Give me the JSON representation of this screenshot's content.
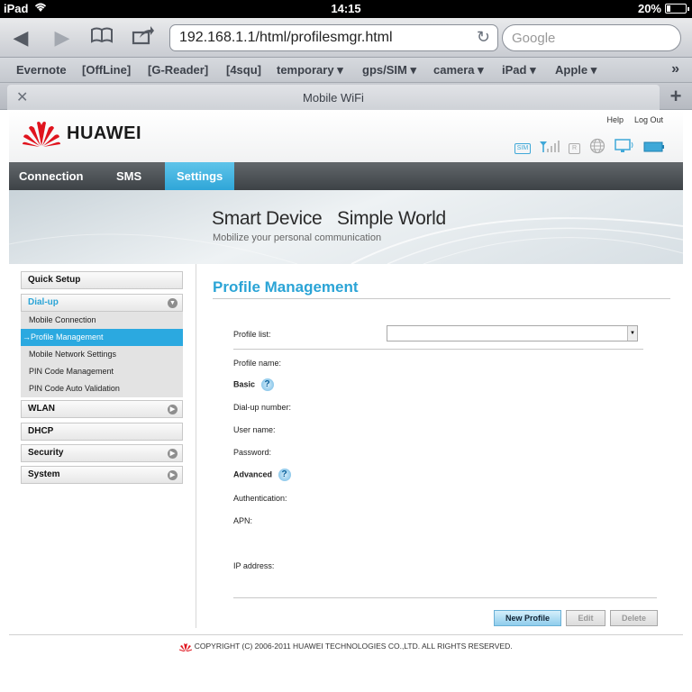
{
  "status_bar": {
    "device": "iPad",
    "time": "14:15",
    "battery_text": "20%",
    "battery_level": 0.2
  },
  "browser": {
    "url": "192.168.1.1/html/profilesmgr.html",
    "search_placeholder": "Google",
    "bookmarks": [
      "Evernote",
      "[OffLine]",
      "[G-Reader]",
      "[4squ]",
      "temporary ▾",
      "gps/SIM ▾",
      "camera ▾",
      "iPad ▾",
      "Apple ▾"
    ],
    "more": "»",
    "tab_title": "Mobile WiFi"
  },
  "header": {
    "brand": "HUAWEI",
    "help": "Help",
    "logout": "Log Out",
    "sim_icon_text": "SIM",
    "roaming_icon_text": "R"
  },
  "nav": {
    "connection": "Connection",
    "sms": "SMS",
    "settings": "Settings"
  },
  "banner": {
    "slogan": "Smart Device   Simple World",
    "sub": "Mobilize your personal communication"
  },
  "sidebar": {
    "quick_setup": "Quick Setup",
    "dialup": "Dial-up",
    "dialup_items": [
      "Mobile Connection",
      "→Profile Management",
      "Mobile Network Settings",
      "PIN Code Management",
      "PIN Code Auto Validation"
    ],
    "wlan": "WLAN",
    "dhcp": "DHCP",
    "security": "Security",
    "system": "System"
  },
  "content": {
    "title": "Profile Management",
    "profile_list": "Profile list:",
    "profile_name": "Profile name:",
    "basic": "Basic",
    "dialup_number": "Dial-up number:",
    "user_name": "User name:",
    "password": "Password:",
    "advanced": "Advanced",
    "authentication": "Authentication:",
    "apn": "APN:",
    "ip_address": "IP address:",
    "help_symbol": "?",
    "new_profile": "New Profile",
    "edit": "Edit",
    "delete": "Delete"
  },
  "footer": {
    "copyright": "COPYRIGHT (C) 2006-2011 HUAWEI TECHNOLOGIES CO.,LTD. ALL RIGHTS RESERVED."
  }
}
